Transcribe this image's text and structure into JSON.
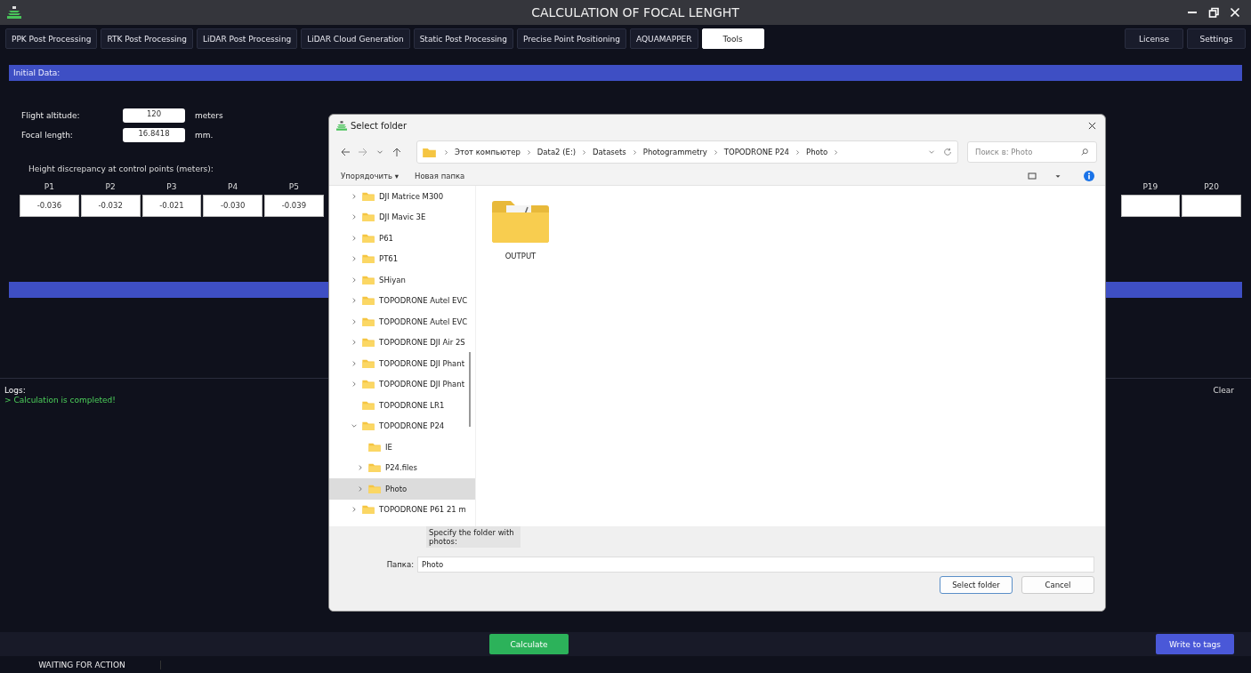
{
  "window": {
    "title": "CALCULATION OF FOCAL LENGHT"
  },
  "tabs": [
    {
      "label": "PPK Post Processing",
      "selected": false
    },
    {
      "label": "RTK Post Processing",
      "selected": false
    },
    {
      "label": "LiDAR Post Processing",
      "selected": false
    },
    {
      "label": "LiDAR Cloud Generation",
      "selected": false
    },
    {
      "label": "Static Post Processing",
      "selected": false
    },
    {
      "label": "Precise Point Positioning",
      "selected": false
    },
    {
      "label": "AQUAMAPPER",
      "selected": false
    },
    {
      "label": "Tools",
      "selected": true
    }
  ],
  "header_buttons": [
    "License",
    "Settings"
  ],
  "initial_data": {
    "title": "Initial Data:",
    "fields": [
      {
        "label": "Flight altitude:",
        "value": "120",
        "unit": "meters"
      },
      {
        "label": "Focal length:",
        "value": "16.8418",
        "unit": "mm."
      }
    ],
    "points_caption": "Height discrepancy at control points (meters):",
    "points_left": [
      {
        "label": "P1",
        "value": "-0.036"
      },
      {
        "label": "P2",
        "value": "-0.032"
      },
      {
        "label": "P3",
        "value": "-0.021"
      },
      {
        "label": "P4",
        "value": "-0.030"
      },
      {
        "label": "P5",
        "value": "-0.039"
      }
    ],
    "points_right": [
      {
        "label": "P19"
      },
      {
        "label": "P20"
      }
    ]
  },
  "logs": {
    "title": "Logs:",
    "clear": "Clear",
    "lines": [
      "> Calculation is completed!"
    ]
  },
  "actions": {
    "calculate": "Calculate",
    "write": "Write to tags"
  },
  "status_bar": {
    "text": "WAITING FOR ACTION"
  },
  "dialog": {
    "title": "Select folder",
    "breadcrumb": [
      "Этот компьютер",
      "Data2 (E:)",
      "Datasets",
      "Photogrammetry",
      "TOPODRONE P24",
      "Photo"
    ],
    "search_placeholder": "Поиск в: Photo",
    "commands": [
      "Упорядочить ▾",
      "Новая папка"
    ],
    "tree": [
      {
        "label": "DJI Matrice M300",
        "has_children": true,
        "expanded": false,
        "selected": false
      },
      {
        "label": "DJI Mavic 3E",
        "has_children": true,
        "expanded": false,
        "selected": false
      },
      {
        "label": "P61",
        "has_children": true,
        "expanded": false,
        "selected": false
      },
      {
        "label": "PT61",
        "has_children": true,
        "expanded": false,
        "selected": false
      },
      {
        "label": "SHiyan",
        "has_children": true,
        "expanded": false,
        "selected": false
      },
      {
        "label": "TOPODRONE Autel EVC",
        "has_children": true,
        "expanded": false,
        "selected": false
      },
      {
        "label": "TOPODRONE Autel EVC",
        "has_children": true,
        "expanded": false,
        "selected": false
      },
      {
        "label": "TOPODRONE DJI Air 2S",
        "has_children": true,
        "expanded": false,
        "selected": false
      },
      {
        "label": "TOPODRONE DJI Phant",
        "has_children": true,
        "expanded": false,
        "selected": false
      },
      {
        "label": "TOPODRONE DJI Phant",
        "has_children": true,
        "expanded": false,
        "selected": false
      },
      {
        "label": "TOPODRONE LR1",
        "has_children": false,
        "selected": false
      },
      {
        "label": "TOPODRONE P24",
        "has_children": true,
        "expanded": true,
        "selected": false,
        "children": [
          {
            "label": "IE",
            "has_children": false,
            "selected": false
          },
          {
            "label": "P24.files",
            "has_children": true,
            "expanded": false,
            "selected": false
          },
          {
            "label": "Photo",
            "has_children": true,
            "expanded": false,
            "selected": true
          }
        ]
      },
      {
        "label": "TOPODRONE P61 21 m",
        "has_children": true,
        "expanded": false,
        "selected": false
      }
    ],
    "files": [
      {
        "label": "OUTPUT"
      }
    ],
    "tooltip": "Specify the folder with photos:",
    "folder_label": "Папка:",
    "folder_value": "Photo",
    "buttons": [
      {
        "label": "Select folder",
        "kind": "primary"
      },
      {
        "label": "Cancel",
        "kind": "secondary"
      }
    ]
  }
}
